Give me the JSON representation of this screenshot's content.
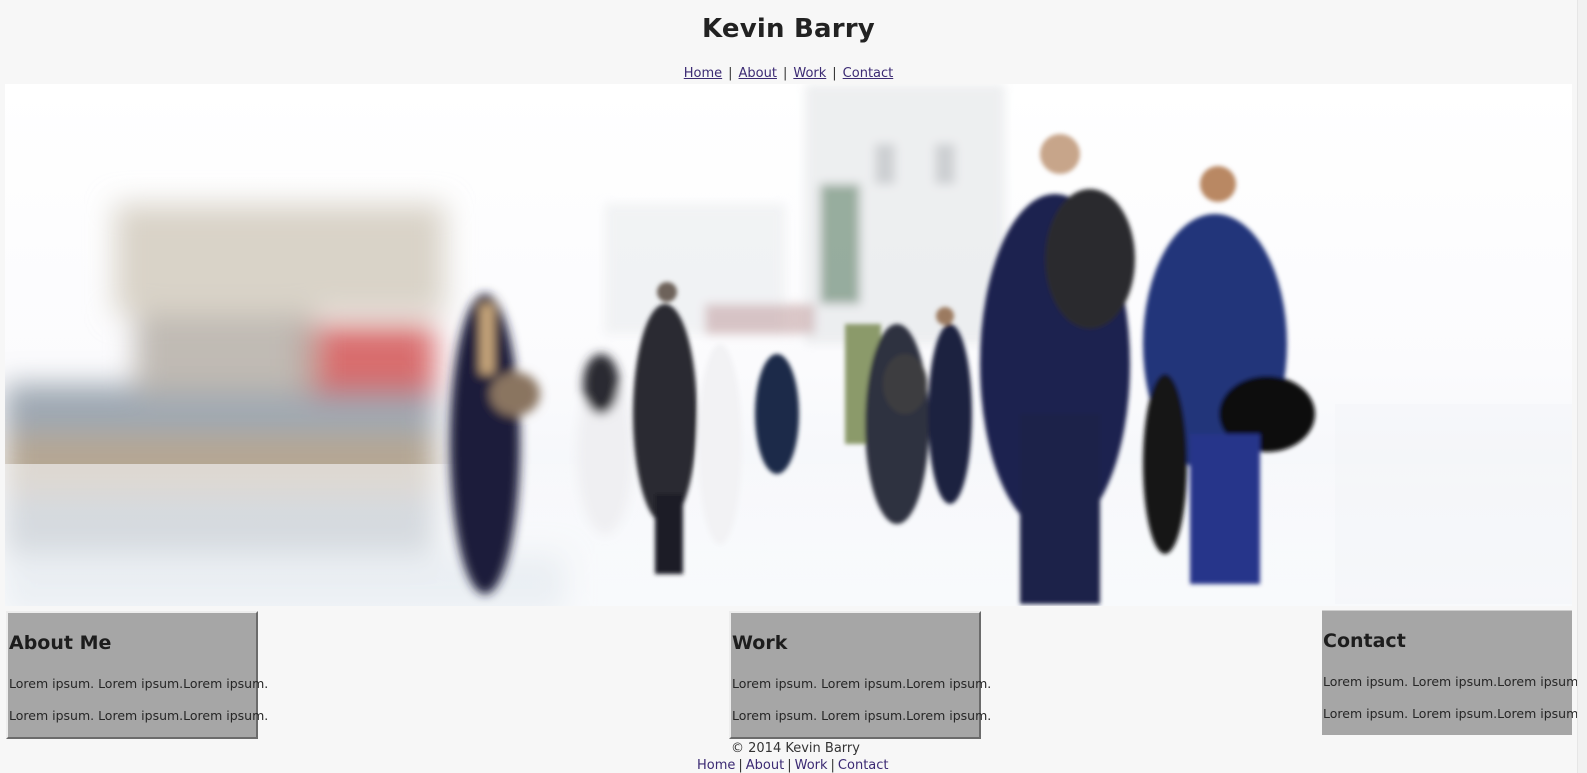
{
  "site": {
    "title": "Kevin Barry"
  },
  "nav": {
    "items": [
      {
        "label": "Home"
      },
      {
        "label": "About"
      },
      {
        "label": "Work"
      },
      {
        "label": "Contact"
      }
    ],
    "separator": "|"
  },
  "hero": {
    "image": "blurred-commuters-photo"
  },
  "panels": {
    "about": {
      "heading": "About Me",
      "text1": "Lorem ipsum. Lorem ipsum.Lorem ipsum.",
      "text2": "Lorem ipsum. Lorem ipsum.Lorem ipsum."
    },
    "work": {
      "heading": "Work",
      "text1": "Lorem ipsum. Lorem ipsum.Lorem ipsum.",
      "text2": "Lorem ipsum. Lorem ipsum.Lorem ipsum."
    },
    "contact": {
      "heading": "Contact",
      "text1": "Lorem ipsum. Lorem ipsum.Lorem ipsum.",
      "text2": "Lorem ipsum. Lorem ipsum.Lorem ipsum."
    }
  },
  "footer": {
    "copyright": "© 2014 Kevin Barry",
    "nav": [
      {
        "label": "Home"
      },
      {
        "label": "About"
      },
      {
        "label": "Work"
      },
      {
        "label": "Contact"
      }
    ],
    "separator": "|"
  },
  "colors": {
    "background": "#f7f7f7",
    "panel": "#a6a6a6",
    "link": "#3b2a73"
  }
}
